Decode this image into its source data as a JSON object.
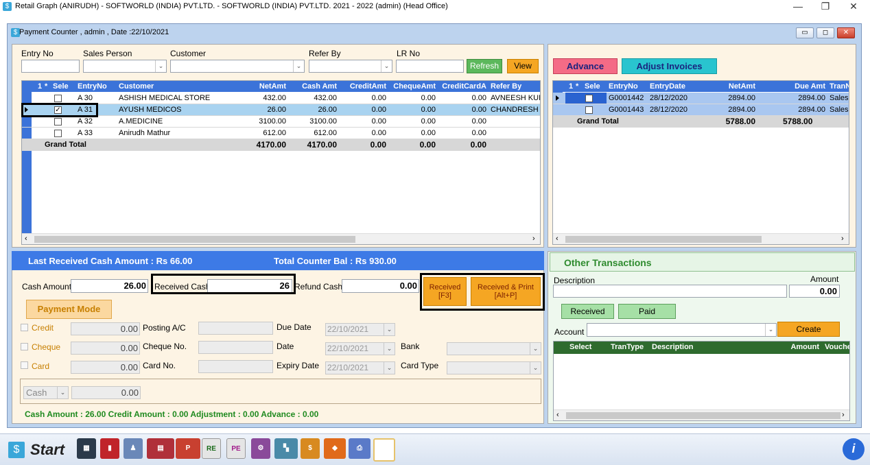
{
  "app": {
    "title": "Retail Graph (ANIRUDH) - SOFTWORLD (INDIA) PVT.LTD. - SOFTWORLD (INDIA) PVT.LTD.  2021 - 2022 (admin) (Head Office)",
    "minimize": "—",
    "restore": "❐",
    "close": "✕"
  },
  "window": {
    "title": "Payment Counter , admin , Date :22/10/2021"
  },
  "filters": {
    "entry_no_label": "Entry No",
    "sales_person_label": "Sales Person",
    "customer_label": "Customer",
    "refer_by_label": "Refer By",
    "lr_no_label": "LR No",
    "refresh_label": "Refresh",
    "view_label": "View"
  },
  "main_grid": {
    "headers": [
      "1",
      "*",
      "Sele",
      "EntryNo",
      "Customer",
      "NetAmt",
      "Cash Amt",
      "CreditAmt",
      "ChequeAmt",
      "CreditCardA",
      "Refer By"
    ],
    "rows": [
      {
        "checked": false,
        "entry": "A 30",
        "customer": "ASHISH MEDICAL STORE",
        "net": "432.00",
        "cash": "432.00",
        "credit": "0.00",
        "cheque": "0.00",
        "card": "0.00",
        "refer": "AVNEESH KUM"
      },
      {
        "checked": true,
        "entry": "A 31",
        "customer": "AYUSH MEDICOS",
        "net": "26.00",
        "cash": "26.00",
        "credit": "0.00",
        "cheque": "0.00",
        "card": "0.00",
        "refer": "CHANDRESH K"
      },
      {
        "checked": false,
        "entry": "A 32",
        "customer": "A.MEDICINE",
        "net": "3100.00",
        "cash": "3100.00",
        "credit": "0.00",
        "cheque": "0.00",
        "card": "0.00",
        "refer": ""
      },
      {
        "checked": false,
        "entry": "A 33",
        "customer": "Anirudh Mathur",
        "net": "612.00",
        "cash": "612.00",
        "credit": "0.00",
        "cheque": "0.00",
        "card": "0.00",
        "refer": ""
      }
    ],
    "total": {
      "label": "Grand Total",
      "net": "4170.00",
      "cash": "4170.00",
      "credit": "0.00",
      "cheque": "0.00",
      "card": "0.00"
    }
  },
  "right": {
    "advance_label": "Advance",
    "adjust_label": "Adjust Invoices",
    "headers": [
      "1",
      "*",
      "Sele",
      "EntryNo",
      "EntryDate",
      "NetAmt",
      "Due Amt",
      "TranNa"
    ],
    "rows": [
      {
        "entry": "G0001442",
        "date": "28/12/2020",
        "net": "2894.00",
        "due": "2894.00",
        "tran": "Sales Inv"
      },
      {
        "entry": "G0001443",
        "date": "28/12/2020",
        "net": "2894.00",
        "due": "2894.00",
        "tran": "Sales Inv"
      }
    ],
    "total": {
      "label": "Grand Total",
      "net": "5788.00",
      "due": "5788.00"
    }
  },
  "info": {
    "last_received": "Last Received Cash Amount : Rs 66.00",
    "counter_bal": "Total Counter Bal : Rs 930.00"
  },
  "payment": {
    "cash_amount_label": "Cash Amount",
    "cash_amount": "26.00",
    "received_cash_label": "Received Cash",
    "received_cash": "26",
    "refund_cash_label": "Refund Cash",
    "refund_cash": "0.00",
    "received_btn_1": "Received",
    "received_btn_2": "[F3]",
    "received_print_1": "Received & Print",
    "received_print_2": "[Alt+P]",
    "payment_mode_label": "Payment Mode",
    "credit_label": "Credit",
    "credit_value": "0.00",
    "posting_ac_label": "Posting A/C",
    "due_date_label": "Due Date",
    "due_date": "22/10/2021",
    "cheque_label": "Cheque",
    "cheque_value": "0.00",
    "cheque_no_label": "Cheque No.",
    "date_label": "Date",
    "date_value": "22/10/2021",
    "bank_label": "Bank",
    "card_label": "Card",
    "card_value": "0.00",
    "card_no_label": "Card No.",
    "expiry_label": "Expiry Date",
    "expiry_value": "22/10/2021",
    "card_type_label": "Card Type",
    "mode_select": "Cash",
    "mode_value": "0.00",
    "status": "Cash Amount : 26.00   Credit Amount : 0.00   Adjustment : 0.00   Advance : 0.00"
  },
  "other": {
    "title": "Other Transactions",
    "description_label": "Description",
    "amount_label": "Amount",
    "amount_value": "0.00",
    "received_label": "Received",
    "paid_label": "Paid",
    "account_label": "Account",
    "create_label": "Create",
    "headers": [
      "Select",
      "TranType",
      "Description",
      "Amount",
      "Vouche"
    ]
  },
  "taskbar": {
    "start_label": "Start"
  }
}
